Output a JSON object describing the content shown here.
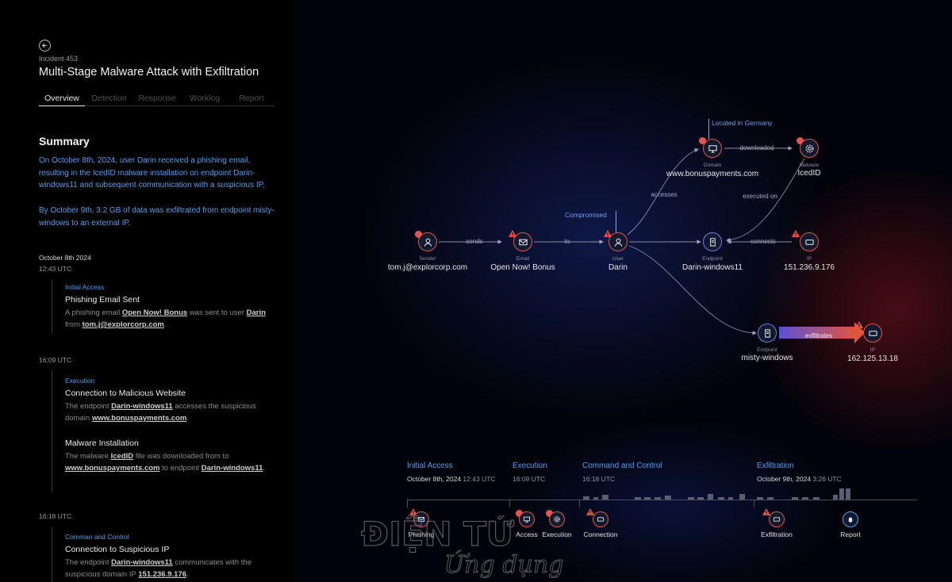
{
  "header": {
    "incident_id": "Incident 453",
    "title": "Multi-Stage Malware Attack with Exfiltration"
  },
  "tabs": [
    {
      "label": "Overview",
      "active": true
    },
    {
      "label": "Detection",
      "active": false
    },
    {
      "label": "Response",
      "active": false
    },
    {
      "label": "Worklog",
      "active": false
    },
    {
      "label": "Report",
      "active": false
    }
  ],
  "summary": {
    "heading": "Summary",
    "paragraph1": "On October 8th, 2024, user Darin received a phishing email, resulting in the IcedID malware installation on endpoint Darin-windows11 and subsequent communication with a suspicious IP.",
    "paragraph2": "By October 9th, 3.2 GB of data was exfiltrated from endpoint misty-windows to an external IP."
  },
  "timeline": {
    "date": "October 8th 2024",
    "groups": [
      {
        "time": "12:43 UTC",
        "events": [
          {
            "tag": "Initial Access",
            "title": "Phishing Email Sent",
            "desc": {
              "t1": "A phishing email ",
              "b1": "Open Now! Bonus",
              "t2": " was sent to user ",
              "b2": "Darin",
              "t3": " from ",
              "b3": "tom.j@explorcorp.com",
              "t4": "."
            }
          }
        ]
      },
      {
        "time": "16:09 UTC",
        "events": [
          {
            "tag": "Execution",
            "title": "Connection to Malicious Website",
            "desc": {
              "t1": "The endpoint ",
              "b1": "Darin-windows11",
              "t2": " accesses the suspicious domain ",
              "b2": "www.bonuspayments.com",
              "t3": "."
            }
          },
          {
            "title": "Malware Installation",
            "desc": {
              "t1": "The malware ",
              "b1": "IcedID",
              "t2": " file was downloaded from to ",
              "b2": "www.bonuspayments.com",
              "t3": " to endpoint ",
              "b3": "Darin-windows11",
              "t4": "."
            }
          }
        ]
      },
      {
        "time": "16:18 UTC",
        "events": [
          {
            "tag": "Comman and Control",
            "title": "Connection to Suspicious IP",
            "desc": {
              "t1": "The endpoint ",
              "b1": "Darin-windows11",
              "t2": " communicates with the suspicious domain IP ",
              "b2": "151.236.9.176",
              "t3": "."
            }
          }
        ]
      }
    ]
  },
  "graph": {
    "nodes": {
      "sender": {
        "type": "Sender",
        "name": "tom.j@explorcorp.com"
      },
      "email": {
        "type": "Email",
        "name": "Open Now! Bonus"
      },
      "user": {
        "type": "User",
        "name": "Darin"
      },
      "domain": {
        "type": "Domain",
        "name": "www.bonuspayments.com"
      },
      "malware": {
        "type": "Malware",
        "name": "IcedID"
      },
      "endpoint1": {
        "type": "Endpoint",
        "name": "Darin-windows11"
      },
      "ip1": {
        "type": "IP",
        "name": "151.236.9.176"
      },
      "endpoint2": {
        "type": "Endpoint",
        "name": "misty-windows"
      },
      "ip2": {
        "type": "IP",
        "name": "162.125.13.18"
      }
    },
    "edges": {
      "sends": "sends",
      "to": "to",
      "accesses": "accesses",
      "downloaded": "downloaded",
      "executed_on": "executed on",
      "connects": "connects",
      "exfiltrates": "exfiltrates"
    },
    "callouts": {
      "domain": "Located in Germany",
      "user": "Compromised"
    }
  },
  "attack_timeline": {
    "phases": [
      {
        "title": "Initial Access",
        "date": "October 8th, 2024",
        "time": "12:43 UTC"
      },
      {
        "title": "Execution",
        "date": "16:09 UTC"
      },
      {
        "title": "Command and Control",
        "date": "16:18 UTC"
      },
      {
        "title": "Exfiltration",
        "date": "October 9th, 2024",
        "time": "3:26 UTC"
      }
    ],
    "markers": {
      "phishing": "Phishing",
      "access": "Access",
      "execution": "Execution",
      "connection": "Connection",
      "exfiltration": "Exfiltration",
      "report": "Report"
    }
  },
  "watermark": {
    "line1": "ĐIỆN TỬ",
    "line2": "Ứng dụng"
  },
  "colors": {
    "accent_blue": "#4ea0ee",
    "alert_red": "#e85345",
    "node_blue": "#6f7ee0",
    "background": "#000000"
  },
  "icons": {
    "back": "arrow-left-icon",
    "sender": "user-icon",
    "email": "envelope-icon",
    "user": "user-icon",
    "domain": "monitor-icon",
    "malware": "gear-icon",
    "endpoint": "device-icon",
    "ip": "network-card-icon",
    "warning": "warning-triangle-icon",
    "threat": "skull-icon",
    "report": "bell-icon"
  }
}
